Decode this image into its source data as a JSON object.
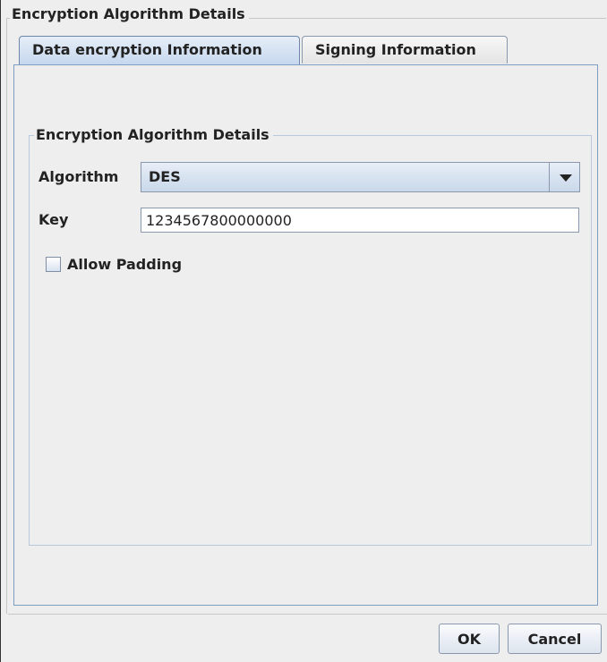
{
  "dialog": {
    "outer_title": "Encryption Algorithm Details"
  },
  "tabs": [
    {
      "label": "Data encryption Information",
      "selected": true
    },
    {
      "label": "Signing Information",
      "selected": false
    }
  ],
  "group": {
    "title": "Encryption Algorithm Details",
    "algorithm_label": "Algorithm",
    "algorithm_value": "DES",
    "key_label": "Key",
    "key_value": "1234567800000000",
    "allow_padding_label": "Allow Padding",
    "allow_padding_checked": false
  },
  "buttons": {
    "ok_label": "OK",
    "cancel_label": "Cancel"
  },
  "icons": {
    "dropdown": "chevron-down-icon",
    "checkbox": "checkbox-unchecked-icon"
  },
  "colors": {
    "background": "#eeeeee",
    "tab_selected": "#c6d7ee",
    "border_accent": "#7f9cc2"
  }
}
